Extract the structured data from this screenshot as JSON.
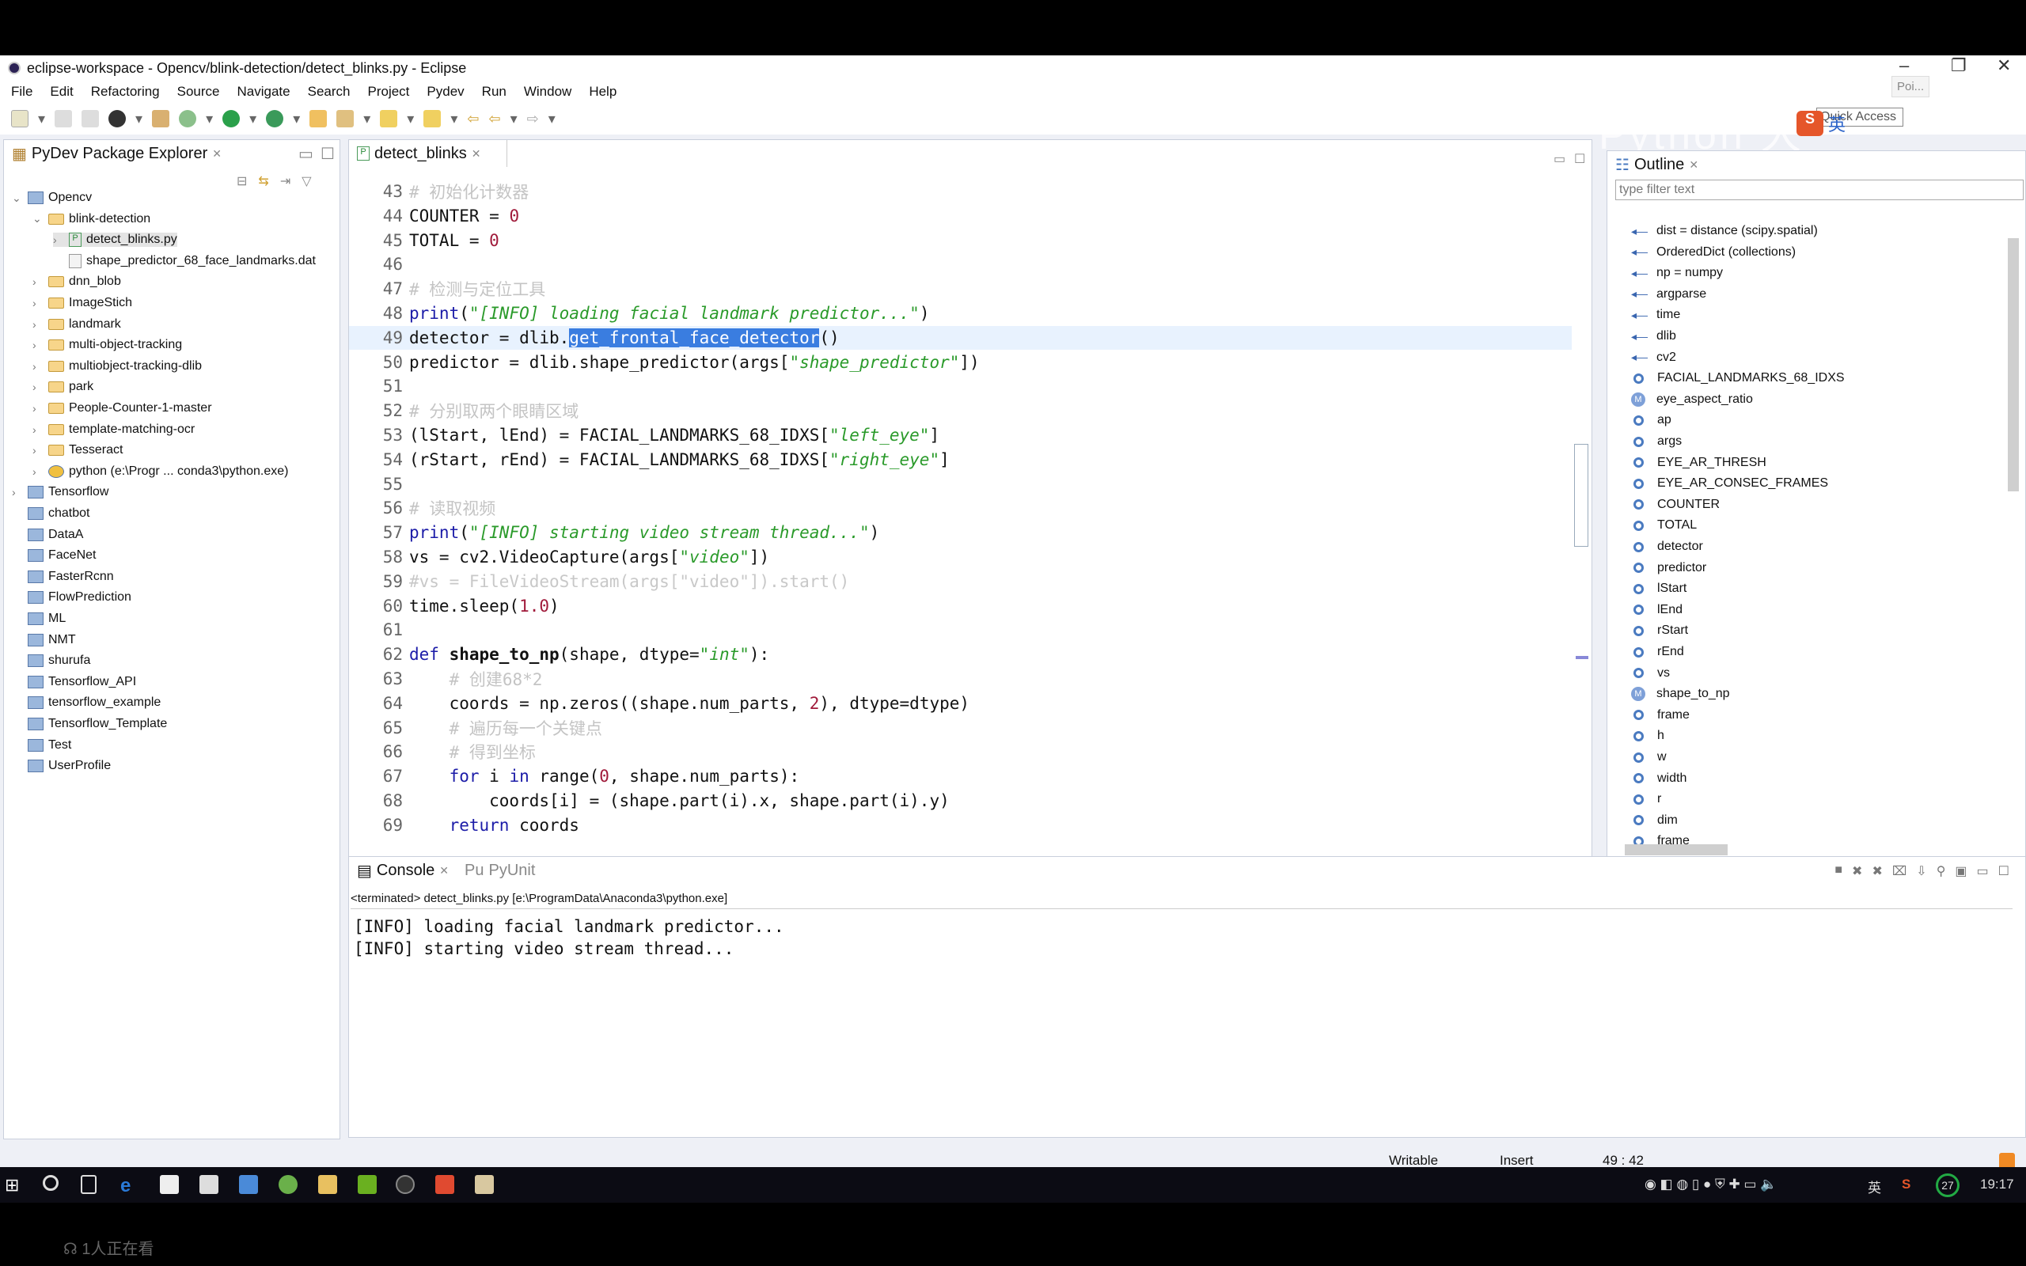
{
  "window": {
    "title": "eclipse-workspace - Opencv/blink-detection/detect_blinks.py - Eclipse"
  },
  "menu": [
    "File",
    "Edit",
    "Refactoring",
    "Source",
    "Navigate",
    "Search",
    "Project",
    "Pydev",
    "Run",
    "Window",
    "Help"
  ],
  "quick_access": {
    "placeholder": "Quick Access",
    "tooltip": "Poi...",
    "overlay_text": "Python 大"
  },
  "explorer": {
    "title": "PyDev Package Explorer",
    "items": [
      {
        "label": "Opencv",
        "icon": "project",
        "level": 0,
        "chev": "v"
      },
      {
        "label": "blink-detection",
        "icon": "folder",
        "level": 1,
        "chev": "v"
      },
      {
        "label": "detect_blinks.py",
        "icon": "python-file",
        "level": 2,
        "chev": ">",
        "selected": true
      },
      {
        "label": "shape_predictor_68_face_landmarks.dat",
        "icon": "file",
        "level": 2,
        "chev": ""
      },
      {
        "label": "dnn_blob",
        "icon": "folder",
        "level": 1,
        "chev": ">"
      },
      {
        "label": "ImageStich",
        "icon": "folder",
        "level": 1,
        "chev": ">"
      },
      {
        "label": "landmark",
        "icon": "folder",
        "level": 1,
        "chev": ">"
      },
      {
        "label": "multi-object-tracking",
        "icon": "folder",
        "level": 1,
        "chev": ">"
      },
      {
        "label": "multiobject-tracking-dlib",
        "icon": "folder",
        "level": 1,
        "chev": ">"
      },
      {
        "label": "park",
        "icon": "folder",
        "level": 1,
        "chev": ">"
      },
      {
        "label": "People-Counter-1-master",
        "icon": "folder",
        "level": 1,
        "chev": ">"
      },
      {
        "label": "template-matching-ocr",
        "icon": "folder",
        "level": 1,
        "chev": ">"
      },
      {
        "label": "Tesseract",
        "icon": "folder",
        "level": 1,
        "chev": ">"
      },
      {
        "label": "python  (e:\\Progr ... conda3\\python.exe)",
        "icon": "python",
        "level": 1,
        "chev": ">"
      },
      {
        "label": "Tensorflow",
        "icon": "project",
        "level": 0,
        "chev": ">"
      },
      {
        "label": "chatbot",
        "icon": "project-closed",
        "level": 0,
        "chev": ""
      },
      {
        "label": "DataA",
        "icon": "project-closed",
        "level": 0,
        "chev": ""
      },
      {
        "label": "FaceNet",
        "icon": "project-closed",
        "level": 0,
        "chev": ""
      },
      {
        "label": "FasterRcnn",
        "icon": "project-closed",
        "level": 0,
        "chev": ""
      },
      {
        "label": "FlowPrediction",
        "icon": "project-closed",
        "level": 0,
        "chev": ""
      },
      {
        "label": "ML",
        "icon": "project-closed",
        "level": 0,
        "chev": ""
      },
      {
        "label": "NMT",
        "icon": "project-closed",
        "level": 0,
        "chev": ""
      },
      {
        "label": "shurufa",
        "icon": "project-closed",
        "level": 0,
        "chev": ""
      },
      {
        "label": "Tensorflow_API",
        "icon": "project-closed",
        "level": 0,
        "chev": ""
      },
      {
        "label": "tensorflow_example",
        "icon": "project-closed",
        "level": 0,
        "chev": ""
      },
      {
        "label": "Tensorflow_Template",
        "icon": "project-closed",
        "level": 0,
        "chev": ""
      },
      {
        "label": "Test",
        "icon": "project-closed",
        "level": 0,
        "chev": ""
      },
      {
        "label": "UserProfile",
        "icon": "project-closed",
        "level": 0,
        "chev": ""
      }
    ]
  },
  "editor": {
    "tab": "detect_blinks",
    "current_line": 49,
    "lines": [
      {
        "n": "43",
        "tokens": [
          [
            "# 初始化计数器",
            "cm"
          ]
        ]
      },
      {
        "n": "44",
        "tokens": [
          [
            "COUNTER = ",
            ""
          ],
          [
            "0",
            "num"
          ]
        ]
      },
      {
        "n": "45",
        "tokens": [
          [
            "TOTAL = ",
            ""
          ],
          [
            "0",
            "num"
          ]
        ]
      },
      {
        "n": "46",
        "tokens": []
      },
      {
        "n": "47",
        "tokens": [
          [
            "# 检测与定位工具",
            "cm"
          ]
        ]
      },
      {
        "n": "48",
        "tokens": [
          [
            "print",
            "kw"
          ],
          [
            "(",
            ""
          ],
          [
            "\"[INFO] loading facial landmark predictor...\"",
            "str"
          ],
          [
            ")",
            ""
          ]
        ]
      },
      {
        "n": "49",
        "tokens": [
          [
            "detector = dlib.",
            ""
          ],
          [
            "get_frontal_face_detector",
            "sel"
          ],
          [
            "()",
            ""
          ]
        ]
      },
      {
        "n": "50",
        "tokens": [
          [
            "predictor = dlib.shape_predictor(args[",
            ""
          ],
          [
            "\"shape_predictor\"",
            "str"
          ],
          [
            "])",
            ""
          ]
        ]
      },
      {
        "n": "51",
        "tokens": []
      },
      {
        "n": "52",
        "tokens": [
          [
            "# 分别取两个眼睛区域",
            "cm"
          ]
        ]
      },
      {
        "n": "53",
        "tokens": [
          [
            "(lStart, lEnd) = FACIAL_LANDMARKS_68_IDXS[",
            ""
          ],
          [
            "\"left_eye\"",
            "str"
          ],
          [
            "]",
            ""
          ]
        ]
      },
      {
        "n": "54",
        "tokens": [
          [
            "(rStart, rEnd) = FACIAL_LANDMARKS_68_IDXS[",
            ""
          ],
          [
            "\"right_eye\"",
            "str"
          ],
          [
            "]",
            ""
          ]
        ]
      },
      {
        "n": "55",
        "tokens": []
      },
      {
        "n": "56",
        "tokens": [
          [
            "# 读取视频",
            "cm"
          ]
        ]
      },
      {
        "n": "57",
        "tokens": [
          [
            "print",
            "kw"
          ],
          [
            "(",
            ""
          ],
          [
            "\"[INFO] starting video stream thread...\"",
            "str"
          ],
          [
            ")",
            ""
          ]
        ]
      },
      {
        "n": "58",
        "tokens": [
          [
            "vs = cv2.VideoCapture(args[",
            ""
          ],
          [
            "\"video\"",
            "str"
          ],
          [
            "])",
            ""
          ]
        ]
      },
      {
        "n": "59",
        "tokens": [
          [
            "#vs = FileVideoStream(args[\"video\"]).start()",
            "dim"
          ]
        ]
      },
      {
        "n": "60",
        "tokens": [
          [
            "time.sleep(",
            ""
          ],
          [
            "1.0",
            "num"
          ],
          [
            ")",
            ""
          ]
        ]
      },
      {
        "n": "61",
        "tokens": []
      },
      {
        "n": "62",
        "tokens": [
          [
            "def ",
            "kw"
          ],
          [
            "shape_to_np",
            "fn"
          ],
          [
            "(shape, dtype=",
            ""
          ],
          [
            "\"int\"",
            "str"
          ],
          [
            "):",
            ""
          ]
        ]
      },
      {
        "n": "63",
        "tokens": [
          [
            "    ",
            ""
          ],
          [
            "# 创建68*2",
            "cm"
          ]
        ]
      },
      {
        "n": "64",
        "tokens": [
          [
            "    coords = np.zeros((shape.num_parts, ",
            ""
          ],
          [
            "2",
            "num"
          ],
          [
            "), dtype=dtype)",
            ""
          ]
        ]
      },
      {
        "n": "65",
        "tokens": [
          [
            "    ",
            ""
          ],
          [
            "# 遍历每一个关键点",
            "cm"
          ]
        ]
      },
      {
        "n": "66",
        "tokens": [
          [
            "    ",
            ""
          ],
          [
            "# 得到坐标",
            "cm"
          ]
        ]
      },
      {
        "n": "67",
        "tokens": [
          [
            "    ",
            ""
          ],
          [
            "for",
            "kw"
          ],
          [
            " i ",
            ""
          ],
          [
            "in",
            "kw"
          ],
          [
            " range(",
            ""
          ],
          [
            "0",
            "num"
          ],
          [
            ", shape.num_parts):",
            ""
          ]
        ]
      },
      {
        "n": "68",
        "tokens": [
          [
            "        coords[i] = (shape.part(i).x, shape.part(i).y)",
            ""
          ]
        ]
      },
      {
        "n": "69",
        "tokens": [
          [
            "    ",
            ""
          ],
          [
            "return",
            "kw"
          ],
          [
            " coords",
            ""
          ]
        ]
      }
    ]
  },
  "outline": {
    "title": "Outline",
    "filter_placeholder": "type filter text",
    "items": [
      {
        "label": "dist = distance (scipy.spatial)",
        "icon": "import"
      },
      {
        "label": "OrderedDict (collections)",
        "icon": "import"
      },
      {
        "label": "np = numpy",
        "icon": "import"
      },
      {
        "label": "argparse",
        "icon": "import"
      },
      {
        "label": "time",
        "icon": "import"
      },
      {
        "label": "dlib",
        "icon": "import"
      },
      {
        "label": "cv2",
        "icon": "import"
      },
      {
        "label": "FACIAL_LANDMARKS_68_IDXS",
        "icon": "variable"
      },
      {
        "label": "eye_aspect_ratio",
        "icon": "method"
      },
      {
        "label": "ap",
        "icon": "variable"
      },
      {
        "label": "args",
        "icon": "variable"
      },
      {
        "label": "EYE_AR_THRESH",
        "icon": "variable"
      },
      {
        "label": "EYE_AR_CONSEC_FRAMES",
        "icon": "variable"
      },
      {
        "label": "COUNTER",
        "icon": "variable"
      },
      {
        "label": "TOTAL",
        "icon": "variable"
      },
      {
        "label": "detector",
        "icon": "variable"
      },
      {
        "label": "predictor",
        "icon": "variable"
      },
      {
        "label": "lStart",
        "icon": "variable"
      },
      {
        "label": "lEnd",
        "icon": "variable"
      },
      {
        "label": "rStart",
        "icon": "variable"
      },
      {
        "label": "rEnd",
        "icon": "variable"
      },
      {
        "label": "vs",
        "icon": "variable"
      },
      {
        "label": "shape_to_np",
        "icon": "method"
      },
      {
        "label": "frame",
        "icon": "variable"
      },
      {
        "label": "h",
        "icon": "variable"
      },
      {
        "label": "w",
        "icon": "variable"
      },
      {
        "label": "width",
        "icon": "variable"
      },
      {
        "label": "r",
        "icon": "variable"
      },
      {
        "label": "dim",
        "icon": "variable"
      },
      {
        "label": "frame",
        "icon": "variable"
      }
    ]
  },
  "console": {
    "tabs": [
      "Console",
      "PyUnit"
    ],
    "header": "<terminated> detect_blinks.py [e:\\ProgramData\\Anaconda3\\python.exe]",
    "output": [
      "[INFO] loading facial landmark predictor...",
      "[INFO] starting video stream thread..."
    ]
  },
  "status": {
    "writable": "Writable",
    "mode": "Insert",
    "position": "49 : 42"
  },
  "ime": {
    "lang": "英"
  },
  "taskbar": {
    "clock": "19:17",
    "badge": "27",
    "tray_lang": "英"
  },
  "viewer": {
    "watching": "1人正在看"
  }
}
